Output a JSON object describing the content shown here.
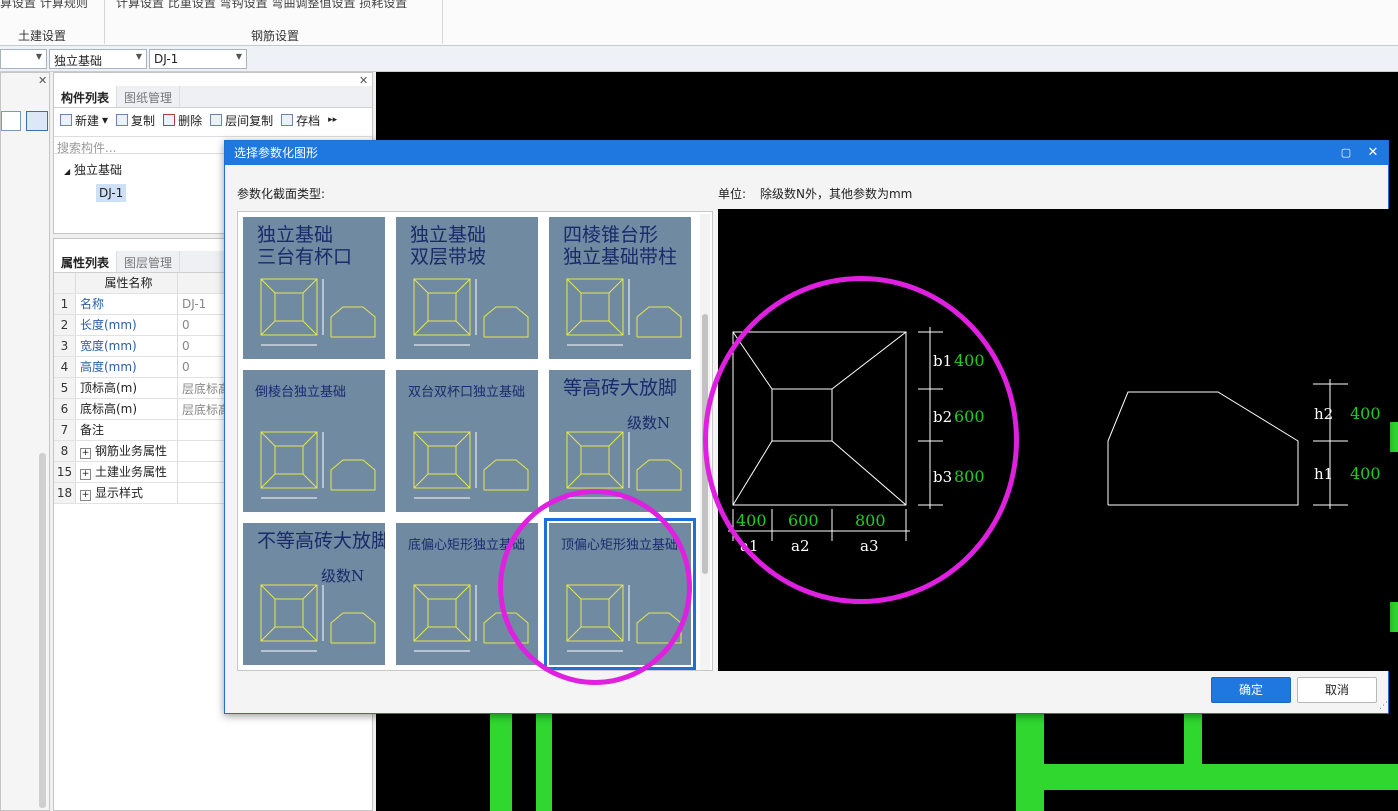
{
  "ribbon": {
    "top_left_text": "算设置  计算规则",
    "top_mid_text": "计算设置  比重设置  弯钩设置  弯曲调整值设置  损耗设置",
    "group_civil": "土建设置",
    "group_rebar": "钢筋设置"
  },
  "selectors": {
    "type_value": "独立基础",
    "item_value": "DJ-1"
  },
  "component_panel": {
    "tabs": [
      "构件列表",
      "图纸管理"
    ],
    "toolbar": {
      "new": "新建",
      "copy": "复制",
      "delete": "删除",
      "floor_copy": "层间复制",
      "save": "存档"
    },
    "search_placeholder": "搜索构件...",
    "tree_root": "独立基础",
    "tree_child": "DJ-1"
  },
  "property_panel": {
    "tabs": [
      "属性列表",
      "图层管理"
    ],
    "header_name": "属性名称",
    "rows": [
      {
        "num": "1",
        "name": "名称",
        "value": "DJ-1",
        "blue": true
      },
      {
        "num": "2",
        "name": "长度(mm)",
        "value": "0",
        "blue": true
      },
      {
        "num": "3",
        "name": "宽度(mm)",
        "value": "0",
        "blue": true
      },
      {
        "num": "4",
        "name": "高度(mm)",
        "value": "0",
        "blue": true
      },
      {
        "num": "5",
        "name": "顶标高(m)",
        "value": "层底标高",
        "blue": false
      },
      {
        "num": "6",
        "name": "底标高(m)",
        "value": "层底标高",
        "blue": false
      },
      {
        "num": "7",
        "name": "备注",
        "value": "",
        "blue": false
      },
      {
        "num": "8",
        "name": "钢筋业务属性",
        "value": "",
        "blue": false,
        "expand": true
      },
      {
        "num": "15",
        "name": "土建业务属性",
        "value": "",
        "blue": false,
        "expand": true
      },
      {
        "num": "18",
        "name": "显示样式",
        "value": "",
        "blue": false,
        "expand": true
      }
    ]
  },
  "dialog": {
    "title": "选择参数化图形",
    "section_label": "参数化截面类型:",
    "unit_label": "单位:",
    "unit_text": "除级数N外，其他参数为mm",
    "ok": "确定",
    "cancel": "取消",
    "thumbnails": [
      {
        "title1": "独立基础",
        "title2": "三台有杯口"
      },
      {
        "title1": "独立基础",
        "title2": "双层带坡"
      },
      {
        "title1": "四棱锥台形",
        "title2": "独立基础带柱"
      },
      {
        "title1": "倒棱台独立基础",
        "title2": ""
      },
      {
        "title1": "双台双杯口独立基础",
        "title2": ""
      },
      {
        "title1": "等高砖大放脚",
        "title2": "级数N"
      },
      {
        "title1": "不等高砖大放脚",
        "title2": "级数N"
      },
      {
        "title1": "底偏心矩形独立基础",
        "title2": ""
      },
      {
        "title1": "顶偏心矩形独立基础",
        "title2": ""
      }
    ],
    "preview": {
      "b1": "400",
      "b2": "600",
      "b3": "800",
      "a1": "400",
      "a2": "600",
      "a3": "800",
      "h1": "400",
      "h2": "400",
      "labels": {
        "b1": "b1",
        "b2": "b2",
        "b3": "b3",
        "a1": "a1",
        "a2": "a2",
        "a3": "a3",
        "h1": "h1",
        "h2": "h2"
      }
    },
    "colors": {
      "highlight_circle": "#e020e0",
      "value_green": "#22cc22",
      "selection": "#1e6fd9"
    }
  }
}
